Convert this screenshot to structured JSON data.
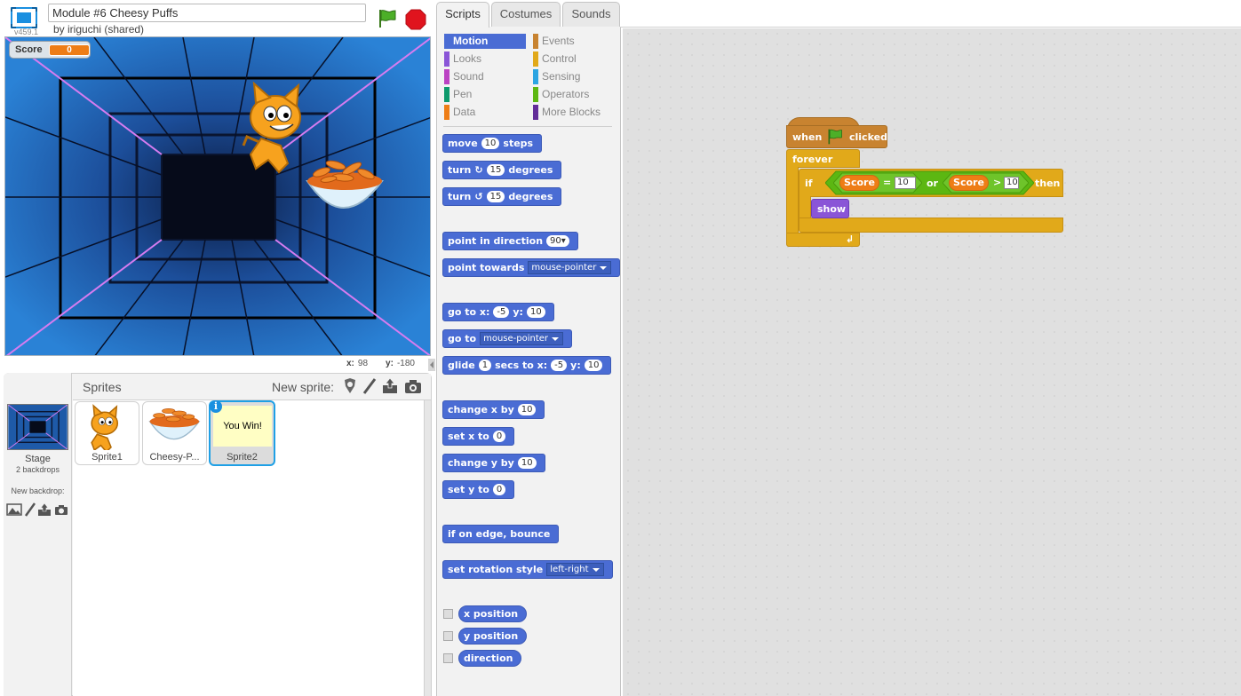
{
  "header": {
    "version": "v459.1",
    "project_title": "Module #6 Cheesy Puffs",
    "author": "by iriguchi (shared)"
  },
  "stage": {
    "score_label": "Score",
    "score_value": "0",
    "x_label": "x:",
    "x_value": "98",
    "y_label": "y:",
    "y_value": "-180"
  },
  "sprites_pane": {
    "title": "Sprites",
    "new_sprite_label": "New sprite:",
    "stage_label": "Stage",
    "backdrops_count": "2 backdrops",
    "new_backdrop_label": "New backdrop:",
    "sprites": [
      {
        "name": "Sprite1"
      },
      {
        "name": "Cheesy-P..."
      },
      {
        "name": "Sprite2",
        "thumb_text": "You Win!"
      }
    ]
  },
  "tabs": [
    "Scripts",
    "Costumes",
    "Sounds"
  ],
  "categories": [
    {
      "label": "Motion",
      "color": "#4a6cd4"
    },
    {
      "label": "Events",
      "color": "#c88330"
    },
    {
      "label": "Looks",
      "color": "#8a55d7"
    },
    {
      "label": "Control",
      "color": "#e1a91a"
    },
    {
      "label": "Sound",
      "color": "#bb42c3"
    },
    {
      "label": "Sensing",
      "color": "#2ca5e2"
    },
    {
      "label": "Pen",
      "color": "#0e9a6c"
    },
    {
      "label": "Operators",
      "color": "#5cb712"
    },
    {
      "label": "Data",
      "color": "#ee7d16"
    },
    {
      "label": "More Blocks",
      "color": "#632d99"
    }
  ],
  "palette": {
    "move": {
      "pre": "move",
      "val": "10",
      "post": "steps"
    },
    "turn_right": {
      "pre": "turn",
      "val": "15",
      "post": "degrees"
    },
    "turn_left": {
      "pre": "turn",
      "val": "15",
      "post": "degrees"
    },
    "point_dir": {
      "pre": "point in direction",
      "val": "90▾"
    },
    "point_towards": {
      "pre": "point towards",
      "val": "mouse-pointer"
    },
    "goto_xy": {
      "pre": "go to x:",
      "x": "-5",
      "mid": "y:",
      "y": "10"
    },
    "goto": {
      "pre": "go to",
      "val": "mouse-pointer"
    },
    "glide": {
      "pre": "glide",
      "secs": "1",
      "mid": "secs to x:",
      "x": "-5",
      "mid2": "y:",
      "y": "10"
    },
    "change_x": {
      "pre": "change x by",
      "val": "10"
    },
    "set_x": {
      "pre": "set x to",
      "val": "0"
    },
    "change_y": {
      "pre": "change y by",
      "val": "10"
    },
    "set_y": {
      "pre": "set y to",
      "val": "0"
    },
    "bounce": {
      "pre": "if on edge, bounce"
    },
    "rotation": {
      "pre": "set rotation style",
      "val": "left-right"
    },
    "x_position": "x position",
    "y_position": "y position",
    "direction": "direction"
  },
  "script": {
    "hat_when": "when",
    "hat_clicked": "clicked",
    "forever": "forever",
    "if": "if",
    "then": "then",
    "var1": "Score",
    "eq": "=",
    "val1": "10",
    "or": "or",
    "var2": "Score",
    "gt": ">",
    "val2": "10",
    "show": "show"
  }
}
